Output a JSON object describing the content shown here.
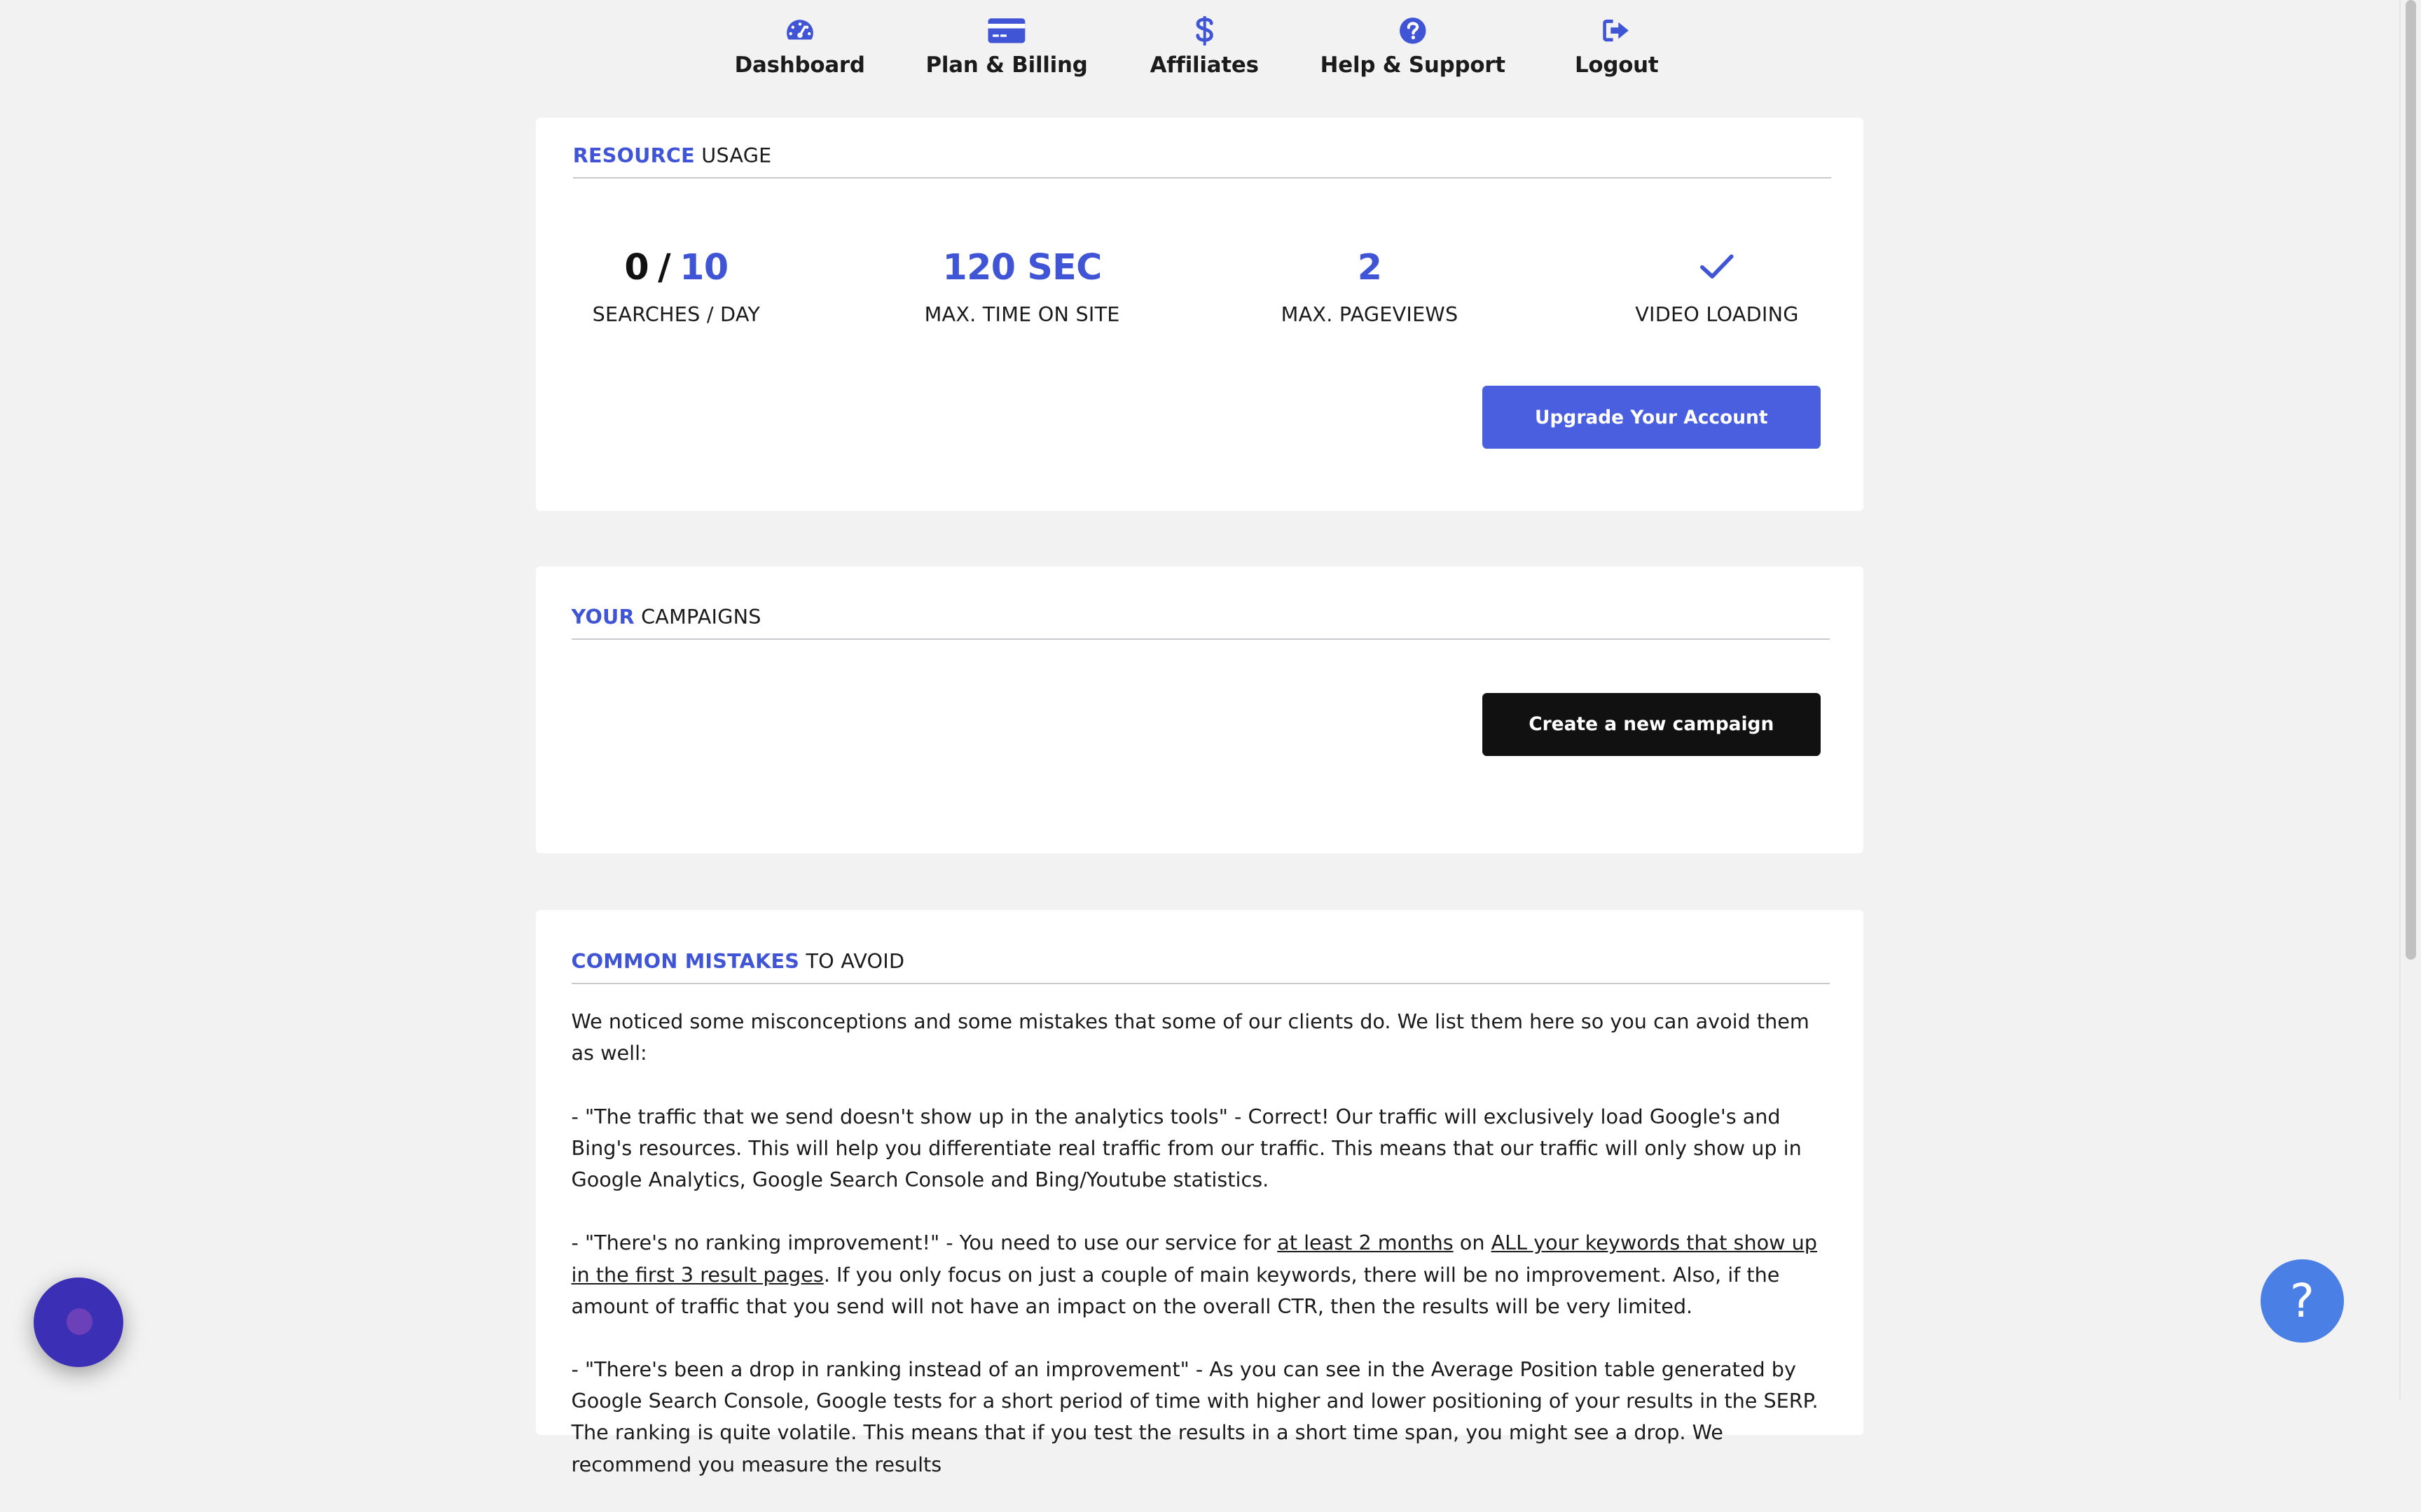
{
  "nav": {
    "items": [
      {
        "label": "Dashboard",
        "icon": "gauge-icon"
      },
      {
        "label": "Plan & Billing",
        "icon": "credit-card-icon"
      },
      {
        "label": "Affiliates",
        "icon": "dollar-icon"
      },
      {
        "label": "Help & Support",
        "icon": "question-circle-icon"
      },
      {
        "label": "Logout",
        "icon": "logout-icon"
      }
    ]
  },
  "resource_usage": {
    "title_accent": "RESOURCE",
    "title_rest": "USAGE",
    "searches_used": "0",
    "searches_separator": "/",
    "searches_limit": "10",
    "searches_label": "SEARCHES / DAY",
    "time_value": "120 SEC",
    "time_label": "MAX. TIME ON SITE",
    "pageviews_value": "2",
    "pageviews_label": "MAX. PAGEVIEWS",
    "video_label": "VIDEO LOADING",
    "upgrade_label": "Upgrade Your Account"
  },
  "campaigns": {
    "title_accent": "YOUR",
    "title_rest": "CAMPAIGNS",
    "create_label": "Create a new campaign"
  },
  "mistakes": {
    "title_accent": "COMMON MISTAKES",
    "title_rest": "TO AVOID",
    "intro": "We noticed some misconceptions and some mistakes that some of our clients do. We list them here so you can avoid them as well:",
    "item1": "- \"The traffic that we send doesn't show up in the analytics tools\" - Correct! Our traffic will exclusively load Google's and Bing's resources. This will help you differentiate real traffic from our traffic. This means that our traffic will only show up in Google Analytics, Google Search Console and Bing/Youtube statistics.",
    "item2_a": "- \"There's no ranking improvement!\" - You need to use our service for ",
    "item2_link1": "at least 2 months",
    "item2_b": " on ",
    "item2_link2": "ALL your keywords that show up in the first 3 result pages",
    "item2_c": ". If you only focus on just a couple of main keywords, there will be no improvement. Also, if the amount of traffic that you send will not have an impact on the overall CTR, then the results will be very limited.",
    "item3": "- \"There's been a drop in ranking instead of an improvement\" - As you can see in the Average Position table generated by Google Search Console, Google tests for a short period of time with higher and lower positioning of your results in the SERP. The ranking is quite volatile. This means that if you test the results in a short time span, you might see a drop. We recommend you measure the results"
  },
  "help_float": {
    "glyph": "?"
  },
  "colors": {
    "accent": "#4054d6",
    "button_blue": "#4a5fe0",
    "button_dark": "#111111",
    "background": "#f2f2f3"
  }
}
